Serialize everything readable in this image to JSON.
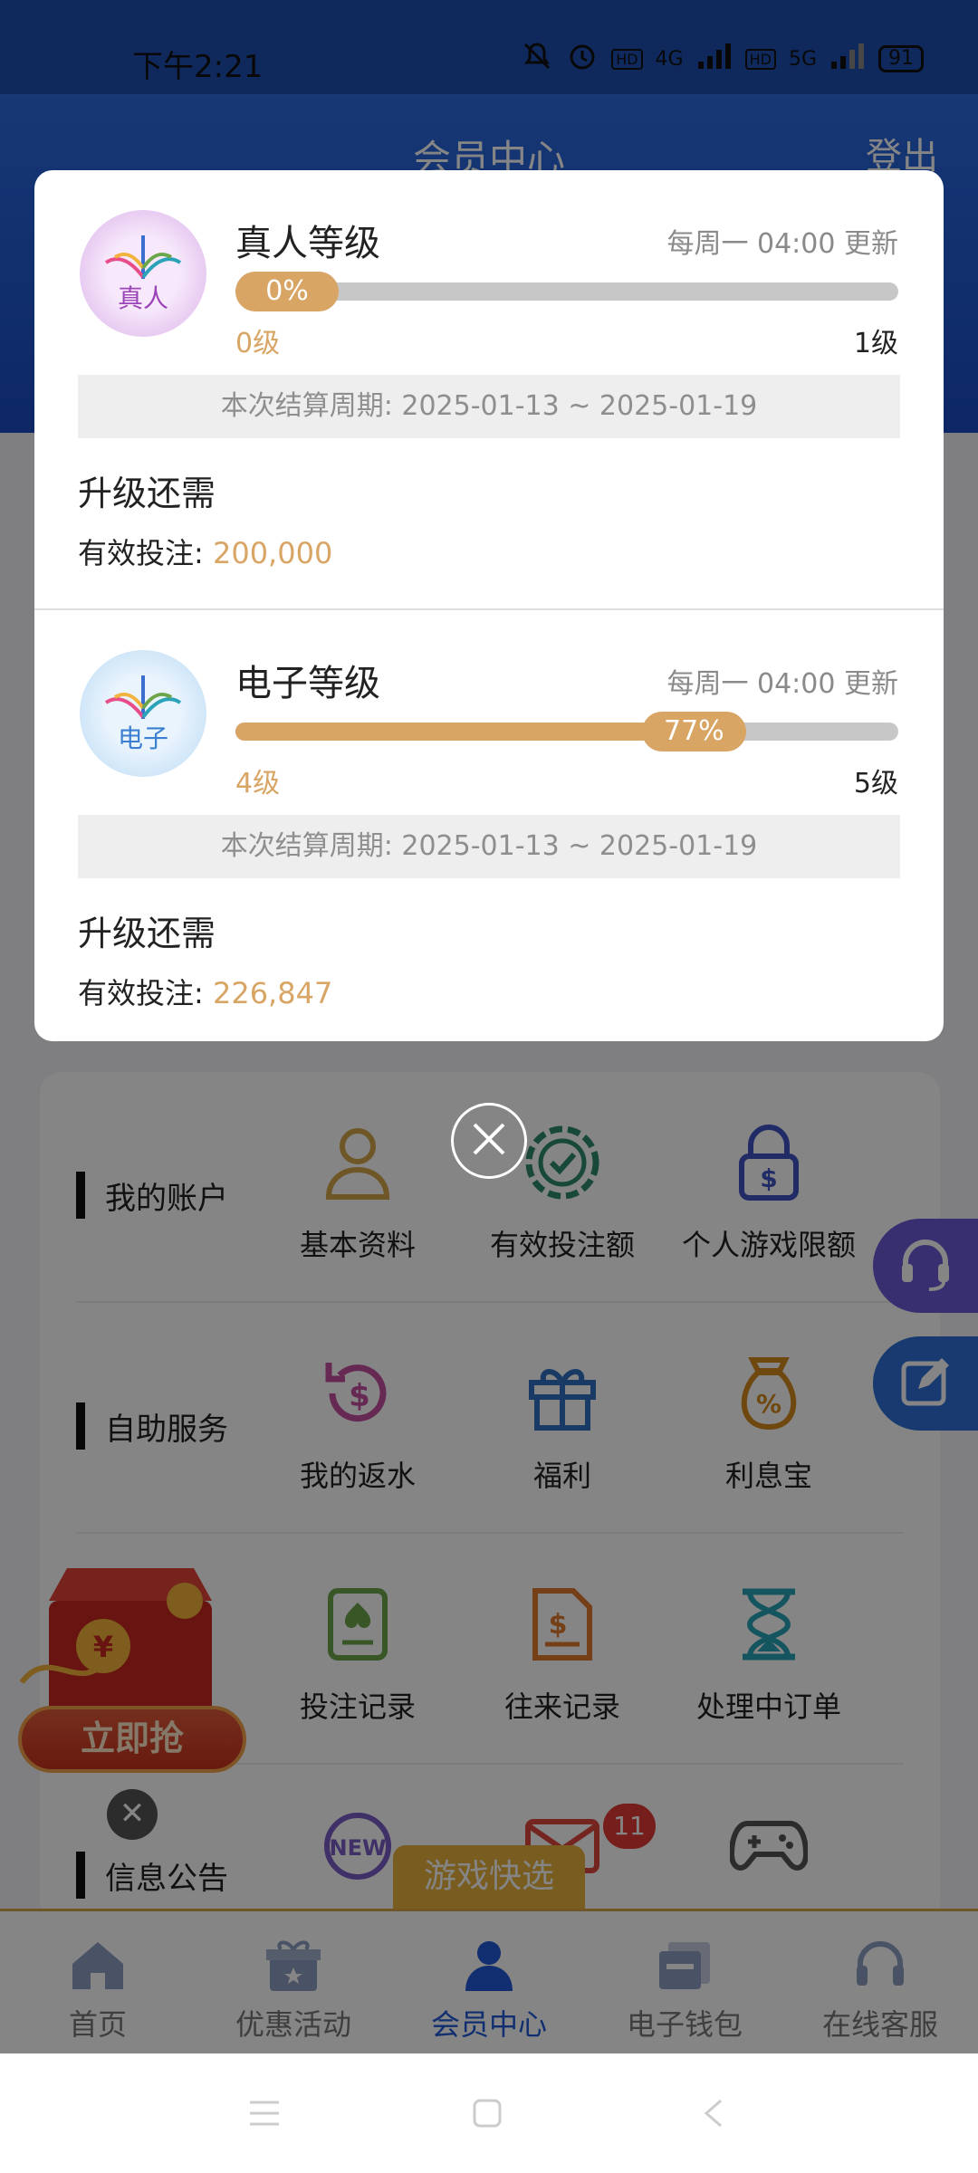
{
  "status_bar": {
    "time": "下午2:21",
    "network": "4G",
    "network2": "5G",
    "battery": "91"
  },
  "header": {
    "title": "会员中心",
    "logout": "登出"
  },
  "menu": {
    "rows": [
      {
        "label": "我的账户",
        "items": [
          {
            "label": "基本资料",
            "icon": "person-icon"
          },
          {
            "label": "有效投注额",
            "icon": "chip-check-icon"
          },
          {
            "label": "个人游戏限额",
            "icon": "lock-dollar-icon"
          }
        ]
      },
      {
        "label": "自助服务",
        "items": [
          {
            "label": "我的返水",
            "icon": "refresh-dollar-icon"
          },
          {
            "label": "福利",
            "icon": "gift-icon"
          },
          {
            "label": "利息宝",
            "icon": "money-bag-icon"
          }
        ]
      },
      {
        "label": "",
        "items": [
          {
            "label": "投注记录",
            "icon": "spade-doc-icon"
          },
          {
            "label": "往来记录",
            "icon": "dollar-doc-icon"
          },
          {
            "label": "处理中订单",
            "icon": "hourglass-icon"
          }
        ]
      },
      {
        "label": "信息公告",
        "items": [
          {
            "label": "",
            "icon": "new-icon"
          },
          {
            "label": "",
            "icon": "mail-icon"
          },
          {
            "label": "",
            "icon": "gamepad-icon"
          }
        ]
      }
    ],
    "mail_badge": "11"
  },
  "promo": {
    "redpack_button": "立即抢",
    "game_pick": "游戏快选"
  },
  "bottom_nav": [
    {
      "label": "首页",
      "icon": "home-icon"
    },
    {
      "label": "优惠活动",
      "icon": "gift-box-icon"
    },
    {
      "label": "会员中心",
      "icon": "user-icon",
      "active": true
    },
    {
      "label": "电子钱包",
      "icon": "wallet-icon"
    },
    {
      "label": "在线客服",
      "icon": "headset-icon"
    }
  ],
  "modal": {
    "sections": [
      {
        "badge_text": "真人",
        "title": "真人等级",
        "refresh": "每周一 04:00 更新",
        "progress_label": "0%",
        "progress": 0.0,
        "current_level": "0级",
        "next_level": "1级",
        "period": "本次结算周期: 2025-01-13 ~ 2025-01-19",
        "upgrade_label": "升级还需",
        "bet_label": "有效投注: ",
        "bet_value": "200,000"
      },
      {
        "badge_text": "电子",
        "title": "电子等级",
        "refresh": "每周一 04:00 更新",
        "progress_label": "77%",
        "progress": 0.77,
        "current_level": "4级",
        "next_level": "5级",
        "period": "本次结算周期: 2025-01-13 ~ 2025-01-19",
        "upgrade_label": "升级还需",
        "bet_label": "有效投注: ",
        "bet_value": "226,847"
      }
    ]
  },
  "colors": {
    "brand_blue": "#1f58d6",
    "gold": "#d8a565",
    "badge_red": "#e23a35"
  }
}
